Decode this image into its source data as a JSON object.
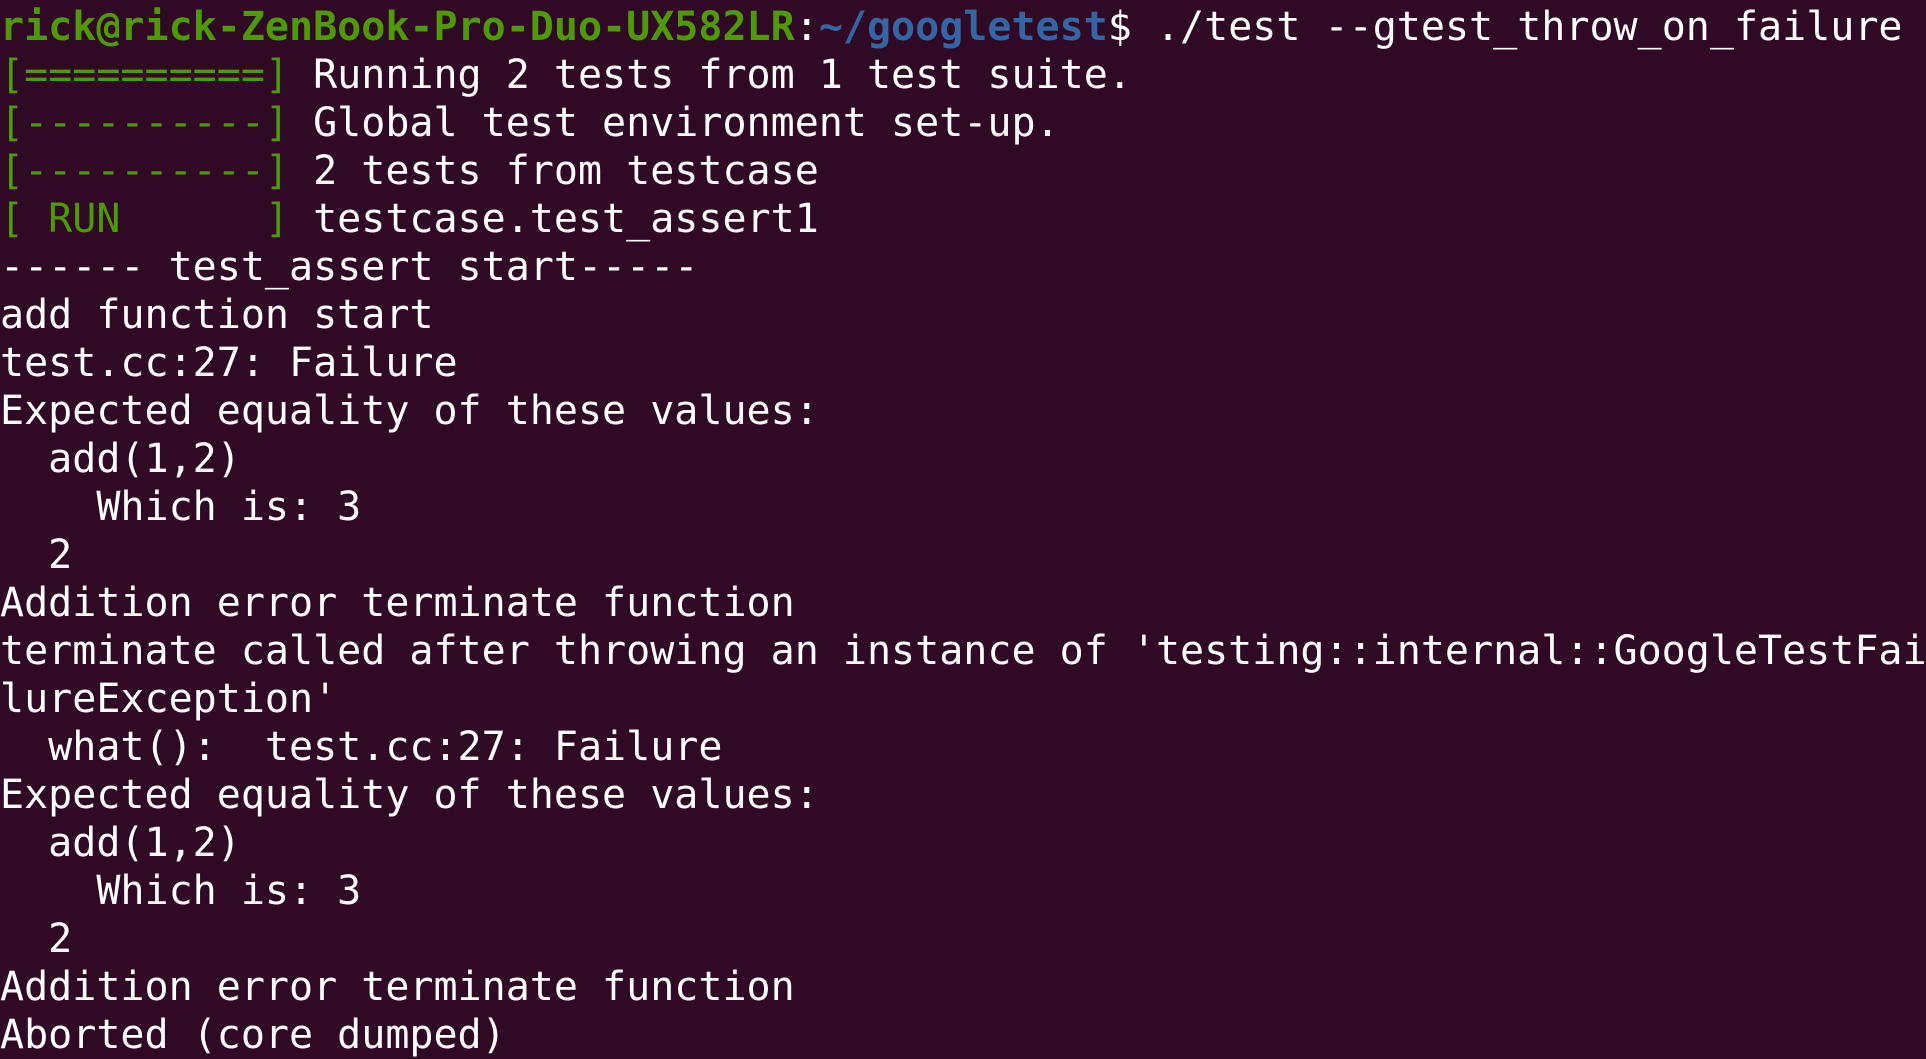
{
  "prompt": {
    "user_host": "rick@rick-ZenBook-Pro-Duo-UX582LR",
    "separator": ":",
    "path": "~/googletest",
    "symbol": "$",
    "command": " ./test --gtest_throw_on_failure"
  },
  "gtest_lines": [
    {
      "tag": "[==========]",
      "text": " Running 2 tests from 1 test suite."
    },
    {
      "tag": "[----------]",
      "text": " Global test environment set-up."
    },
    {
      "tag": "[----------]",
      "text": " 2 tests from testcase"
    },
    {
      "tag": "[ RUN      ]",
      "text": " testcase.test_assert1"
    }
  ],
  "output_lines": [
    "------ test_assert start-----",
    "add function start",
    "test.cc:27: Failure",
    "Expected equality of these values:",
    "  add(1,2)",
    "    Which is: 3",
    "  2",
    "Addition error terminate function",
    "terminate called after throwing an instance of 'testing::internal::GoogleTestFai",
    "lureException'",
    "  what():  test.cc:27: Failure",
    "Expected equality of these values:",
    "  add(1,2)",
    "    Which is: 3",
    "  2",
    "Addition error terminate function",
    "Aborted (core dumped)"
  ],
  "colors": {
    "background": "#300a24",
    "foreground": "#ffffff",
    "green": "#4e9a06",
    "blue": "#3465a4"
  }
}
